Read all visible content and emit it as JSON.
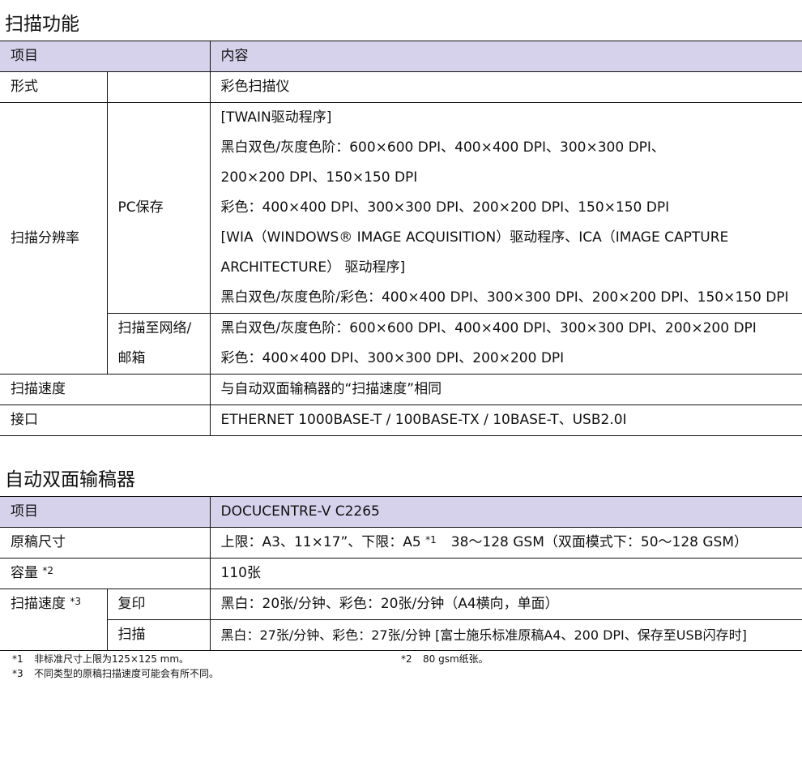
{
  "scan": {
    "title": "扫描功能",
    "header": {
      "item": "项目",
      "content": "内容"
    },
    "form": {
      "label": "形式",
      "value": "彩色扫描仪"
    },
    "resolution": {
      "label": "扫描分辨率",
      "pc": {
        "label": "PC保存",
        "lines": [
          "[TWAIN驱动程序]",
          "黑白双色/灰度色阶：600×600 DPI、400×400 DPI、300×300 DPI、",
          "200×200 DPI、150×150 DPI",
          "彩色：400×400 DPI、300×300 DPI、200×200 DPI、150×150 DPI",
          "[WIA（WINDOWS® IMAGE ACQUISITION）驱动程序、ICA（IMAGE CAPTURE",
          "ARCHITECTURE） 驱动程序]",
          "黑白双色/灰度色阶/彩色：400×400 DPI、300×300 DPI、200×200 DPI、150×150 DPI"
        ]
      },
      "network": {
        "label_lines": [
          "扫描至网络/",
          "邮箱"
        ],
        "lines": [
          "黑白双色/灰度色阶：600×600 DPI、400×400 DPI、300×300 DPI、200×200 DPI",
          "彩色：400×400 DPI、300×300 DPI、200×200 DPI"
        ]
      }
    },
    "speed": {
      "label": "扫描速度",
      "value": "与自动双面输稿器的“扫描速度”相同"
    },
    "interface": {
      "label": "接口",
      "value": "ETHERNET 1000BASE-T / 100BASE-TX / 10BASE-T、USB2.0I"
    }
  },
  "adf": {
    "title": "自动双面输稿器",
    "header": {
      "item": "项目",
      "model": "DOCUCENTRE-V C2265"
    },
    "doc_size": {
      "label": "原稿尺寸",
      "value_a": "上限：A3、11×17”、下限：A5",
      "note": "*1",
      "value_b": "38～128 GSM（双面模式下：50～128 GSM）"
    },
    "capacity": {
      "label": "容量",
      "note": "*2",
      "value": "110张"
    },
    "scan_speed": {
      "label": "扫描速度",
      "note": "*3",
      "copy": {
        "label": "复印",
        "value": "黑白：20张/分钟、彩色：20张/分钟（A4横向，单面）"
      },
      "scan": {
        "label": "扫描",
        "value": "黑白：27张/分钟、彩色：27张/分钟 [富士施乐标准原稿A4、200 DPI、保存至USB闪存时]"
      }
    }
  },
  "footnotes": [
    {
      "mark": "*1",
      "text": "非标准尺寸上限为125×125 mm。"
    },
    {
      "mark": "*2",
      "text": "80 gsm纸张。"
    },
    {
      "mark": "*3",
      "text": "不同类型的原稿扫描速度可能会有所不同。"
    }
  ]
}
